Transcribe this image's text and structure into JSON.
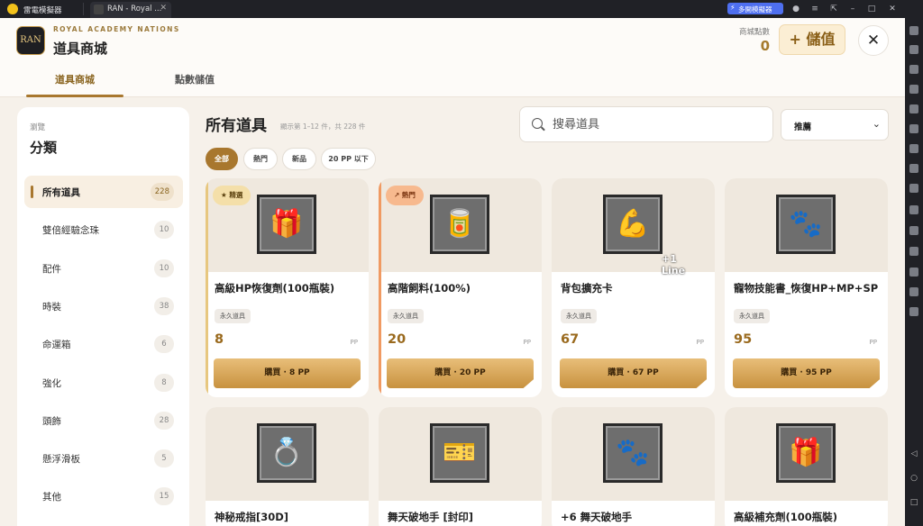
{
  "emulator": {
    "app_name": "雷電模擬器",
    "tab_title": "RAN - Royal ...",
    "multi_button": "多開模擬器"
  },
  "header": {
    "logo_text": "RAN",
    "subtitle": "ROYAL ACADEMY NATIONS",
    "title": "道具商城",
    "points_label": "商城點數",
    "points_value": "0",
    "topup_label": "+ 儲值",
    "close_label": "✕"
  },
  "tabs": [
    {
      "label": "道具商城",
      "active": true
    },
    {
      "label": "點數儲值",
      "active": false
    }
  ],
  "sidebar": {
    "subtitle": "瀏覽",
    "title": "分類",
    "categories": [
      {
        "label": "所有道具",
        "count": "228",
        "active": true
      },
      {
        "label": "雙倍經驗念珠",
        "count": "10"
      },
      {
        "label": "配件",
        "count": "10"
      },
      {
        "label": "時裝",
        "count": "38"
      },
      {
        "label": "命運箱",
        "count": "6"
      },
      {
        "label": "強化",
        "count": "8"
      },
      {
        "label": "頭飾",
        "count": "28"
      },
      {
        "label": "懸浮滑板",
        "count": "5"
      },
      {
        "label": "其他",
        "count": "15"
      }
    ]
  },
  "main": {
    "title": "所有道具",
    "count_text": "顯示第 1–12 件，共 228 件",
    "search_placeholder": "搜尋道具",
    "sort_value": "推薦",
    "filters": [
      "全部",
      "熱門",
      "新品",
      "20 PP 以下"
    ],
    "active_filter": "全部"
  },
  "products": [
    {
      "name": "高級HP恢復劑(100瓶裝)",
      "tag": "永久道具",
      "price": "8",
      "unit": "PP",
      "buy": "購買 · 8 PP",
      "badge": "★ 精選",
      "badge_type": "feat",
      "icon": "gift-box-icon"
    },
    {
      "name": "高階飼料(100%)",
      "tag": "永久道具",
      "price": "20",
      "unit": "PP",
      "buy": "購買 · 20 PP",
      "badge": "↗ 熱門",
      "badge_type": "hot",
      "icon": "feed-can-icon"
    },
    {
      "name": "背包擴充卡",
      "tag": "永久道具",
      "price": "67",
      "unit": "PP",
      "buy": "購買 · 67 PP",
      "icon": "bag-expand-icon",
      "overlay": "+1 Line"
    },
    {
      "name": "寵物技能書_恢復HP+MP+SP",
      "tag": "永久道具",
      "price": "95",
      "unit": "PP",
      "buy": "購買 · 95 PP",
      "icon": "paw-scroll-icon"
    },
    {
      "name": "神秘戒指[30D]",
      "icon": "ring-icon"
    },
    {
      "name": "舞天破地手 [封印]",
      "icon": "ticket-icon"
    },
    {
      "name": "+6 舞天破地手",
      "icon": "paw-scroll-icon"
    },
    {
      "name": "高級補充劑(100瓶裝)",
      "icon": "gift-box-icon"
    }
  ],
  "colors": {
    "accent": "#a8772e",
    "price": "#9a6a1e",
    "background": "#f6f1ea"
  }
}
